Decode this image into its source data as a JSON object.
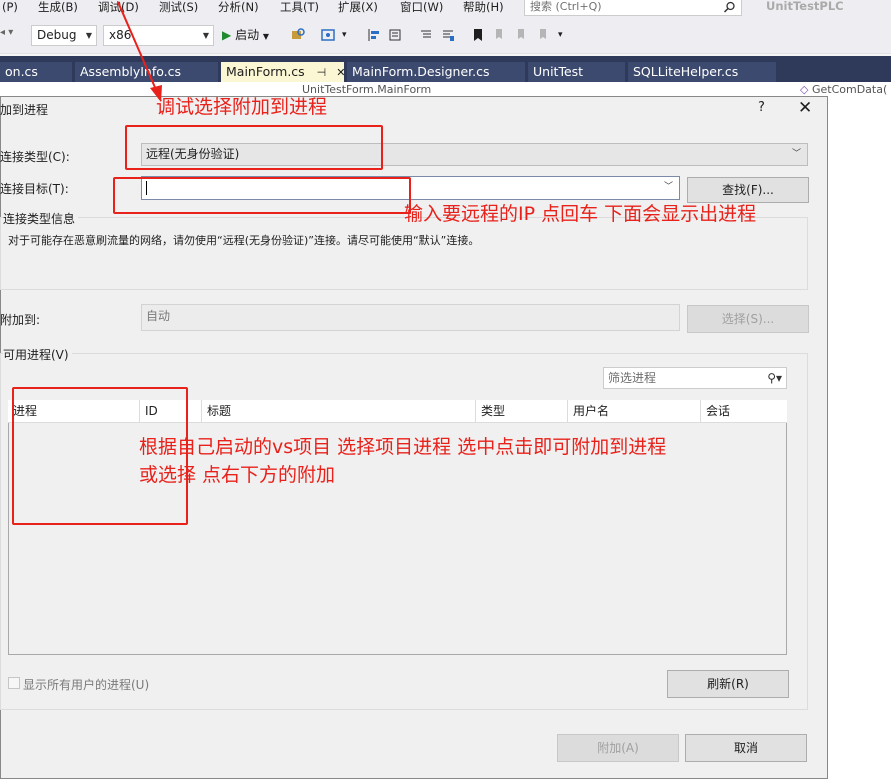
{
  "menubar": {
    "items": [
      "(P)",
      "生成(B)",
      "调试(D)",
      "测试(S)",
      "分析(N)",
      "工具(T)",
      "扩展(X)",
      "窗口(W)",
      "帮助(H)"
    ],
    "search_placeholder": "搜索 (Ctrl+Q)",
    "app_title": "UnitTestPLC"
  },
  "toolbar": {
    "config": "Debug",
    "platform": "x86",
    "start_label": "启动"
  },
  "tabs": [
    {
      "label": "on.cs"
    },
    {
      "label": "AssemblyInfo.cs"
    },
    {
      "label": "MainForm.cs",
      "pin": "⊣",
      "close": "✕"
    },
    {
      "label": "MainForm.Designer.cs"
    },
    {
      "label": "UnitTest"
    },
    {
      "label": "SQLLiteHelper.cs"
    }
  ],
  "editor": {
    "nav_left": "UnitTestForm.MainForm",
    "nav_right": "GetComData("
  },
  "dialog": {
    "title": "加到进程",
    "help": "?",
    "close": "✕",
    "connection_type_label": "连接类型(C):",
    "connection_type_value": "远程(无身份验证)",
    "connection_target_label": "连接目标(T):",
    "connection_target_value": "",
    "find_button": "查找(F)...",
    "info_group_label": "连接类型信息",
    "info_text": "对于可能存在恶意刷流量的网络，请勿使用“远程(无身份验证)”连接。请尽可能使用“默认”连接。",
    "attach_to_label": "附加到:",
    "attach_to_value": "自动",
    "select_button": "选择(S)...",
    "available_processes_label": "可用进程(V)",
    "filter_placeholder": "筛选进程",
    "columns": [
      "进程",
      "ID",
      "标题",
      "类型",
      "用户名",
      "会话"
    ],
    "show_all_users": "显示所有用户的进程(U)",
    "refresh_button": "刷新(R)",
    "attach_button": "附加(A)",
    "cancel_button": "取消"
  },
  "annotations": {
    "a1": "调试选择附加到进程",
    "a2": "输入要远程的IP 点回车 下面会显示出进程",
    "a3_line1": "根据自己启动的vs项目 选择项目进程 选中点击即可附加到进程",
    "a3_line2": "或选择 点右下方的附加",
    "color": "#e8211b"
  }
}
